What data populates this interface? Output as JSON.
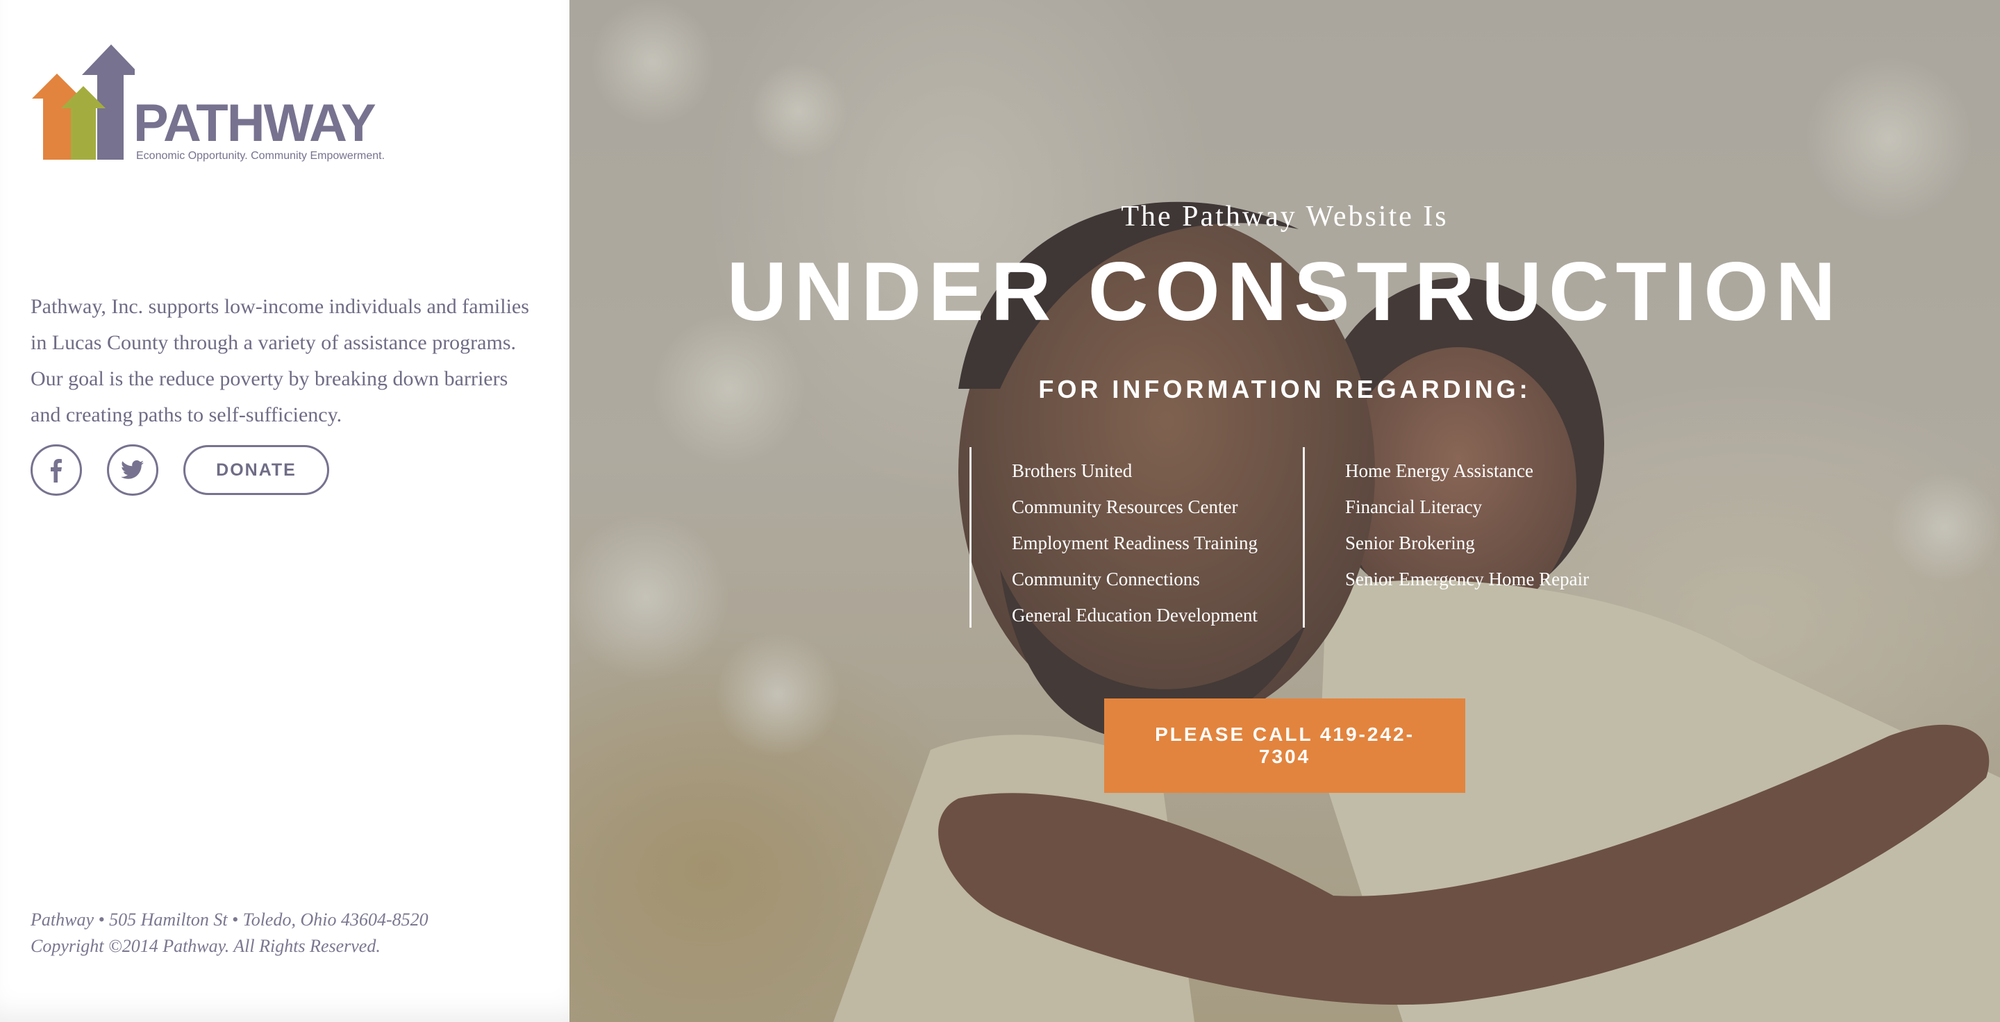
{
  "brand": {
    "name": "PATHWAY",
    "tagline": "Economic Opportunity. Community Empowerment.",
    "colors": {
      "arrow_orange": "#e2843e",
      "arrow_green": "#a3ad3f",
      "arrow_purple": "#77728f",
      "text_purple": "#77728f",
      "cta_orange": "#e2843e"
    }
  },
  "sidebar": {
    "about": "Pathway, Inc. supports low-income individuals and families in Lucas County through a variety of assistance programs. Our goal is the reduce poverty by breaking down barriers and creating paths to self-sufficiency.",
    "social": [
      {
        "icon": "facebook-icon",
        "glyph": "f"
      },
      {
        "icon": "twitter-icon",
        "glyph": "bird"
      }
    ],
    "donate_label": "DONATE",
    "footer_address": "Pathway • 505 Hamilton St • Toledo, Ohio 43604-8520",
    "footer_copyright": "Copyright ©2014 Pathway. All Rights Reserved."
  },
  "hero": {
    "kicker": "The Pathway Website Is",
    "headline": "UNDER CONSTRUCTION",
    "subhead": "FOR INFORMATION REGARDING:",
    "programs_left": [
      "Brothers United",
      "Community Resources Center",
      "Employment Readiness Training",
      "Community Connections",
      "General Education Development"
    ],
    "programs_right": [
      "Home Energy Assistance",
      "Financial Literacy",
      "Senior Brokering",
      "Senior Emergency Home Repair"
    ],
    "cta_label": "PLEASE CALL 419-242-7304"
  }
}
